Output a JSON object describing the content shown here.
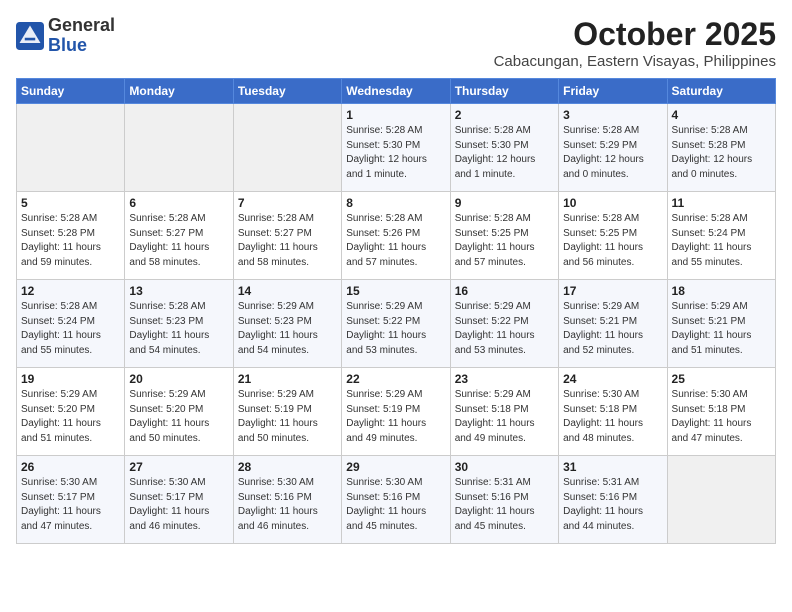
{
  "logo": {
    "general": "General",
    "blue": "Blue"
  },
  "header": {
    "month": "October 2025",
    "location": "Cabacungan, Eastern Visayas, Philippines"
  },
  "weekdays": [
    "Sunday",
    "Monday",
    "Tuesday",
    "Wednesday",
    "Thursday",
    "Friday",
    "Saturday"
  ],
  "weeks": [
    [
      {
        "day": "",
        "info": ""
      },
      {
        "day": "",
        "info": ""
      },
      {
        "day": "",
        "info": ""
      },
      {
        "day": "1",
        "info": "Sunrise: 5:28 AM\nSunset: 5:30 PM\nDaylight: 12 hours\nand 1 minute."
      },
      {
        "day": "2",
        "info": "Sunrise: 5:28 AM\nSunset: 5:30 PM\nDaylight: 12 hours\nand 1 minute."
      },
      {
        "day": "3",
        "info": "Sunrise: 5:28 AM\nSunset: 5:29 PM\nDaylight: 12 hours\nand 0 minutes."
      },
      {
        "day": "4",
        "info": "Sunrise: 5:28 AM\nSunset: 5:28 PM\nDaylight: 12 hours\nand 0 minutes."
      }
    ],
    [
      {
        "day": "5",
        "info": "Sunrise: 5:28 AM\nSunset: 5:28 PM\nDaylight: 11 hours\nand 59 minutes."
      },
      {
        "day": "6",
        "info": "Sunrise: 5:28 AM\nSunset: 5:27 PM\nDaylight: 11 hours\nand 58 minutes."
      },
      {
        "day": "7",
        "info": "Sunrise: 5:28 AM\nSunset: 5:27 PM\nDaylight: 11 hours\nand 58 minutes."
      },
      {
        "day": "8",
        "info": "Sunrise: 5:28 AM\nSunset: 5:26 PM\nDaylight: 11 hours\nand 57 minutes."
      },
      {
        "day": "9",
        "info": "Sunrise: 5:28 AM\nSunset: 5:25 PM\nDaylight: 11 hours\nand 57 minutes."
      },
      {
        "day": "10",
        "info": "Sunrise: 5:28 AM\nSunset: 5:25 PM\nDaylight: 11 hours\nand 56 minutes."
      },
      {
        "day": "11",
        "info": "Sunrise: 5:28 AM\nSunset: 5:24 PM\nDaylight: 11 hours\nand 55 minutes."
      }
    ],
    [
      {
        "day": "12",
        "info": "Sunrise: 5:28 AM\nSunset: 5:24 PM\nDaylight: 11 hours\nand 55 minutes."
      },
      {
        "day": "13",
        "info": "Sunrise: 5:28 AM\nSunset: 5:23 PM\nDaylight: 11 hours\nand 54 minutes."
      },
      {
        "day": "14",
        "info": "Sunrise: 5:29 AM\nSunset: 5:23 PM\nDaylight: 11 hours\nand 54 minutes."
      },
      {
        "day": "15",
        "info": "Sunrise: 5:29 AM\nSunset: 5:22 PM\nDaylight: 11 hours\nand 53 minutes."
      },
      {
        "day": "16",
        "info": "Sunrise: 5:29 AM\nSunset: 5:22 PM\nDaylight: 11 hours\nand 53 minutes."
      },
      {
        "day": "17",
        "info": "Sunrise: 5:29 AM\nSunset: 5:21 PM\nDaylight: 11 hours\nand 52 minutes."
      },
      {
        "day": "18",
        "info": "Sunrise: 5:29 AM\nSunset: 5:21 PM\nDaylight: 11 hours\nand 51 minutes."
      }
    ],
    [
      {
        "day": "19",
        "info": "Sunrise: 5:29 AM\nSunset: 5:20 PM\nDaylight: 11 hours\nand 51 minutes."
      },
      {
        "day": "20",
        "info": "Sunrise: 5:29 AM\nSunset: 5:20 PM\nDaylight: 11 hours\nand 50 minutes."
      },
      {
        "day": "21",
        "info": "Sunrise: 5:29 AM\nSunset: 5:19 PM\nDaylight: 11 hours\nand 50 minutes."
      },
      {
        "day": "22",
        "info": "Sunrise: 5:29 AM\nSunset: 5:19 PM\nDaylight: 11 hours\nand 49 minutes."
      },
      {
        "day": "23",
        "info": "Sunrise: 5:29 AM\nSunset: 5:18 PM\nDaylight: 11 hours\nand 49 minutes."
      },
      {
        "day": "24",
        "info": "Sunrise: 5:30 AM\nSunset: 5:18 PM\nDaylight: 11 hours\nand 48 minutes."
      },
      {
        "day": "25",
        "info": "Sunrise: 5:30 AM\nSunset: 5:18 PM\nDaylight: 11 hours\nand 47 minutes."
      }
    ],
    [
      {
        "day": "26",
        "info": "Sunrise: 5:30 AM\nSunset: 5:17 PM\nDaylight: 11 hours\nand 47 minutes."
      },
      {
        "day": "27",
        "info": "Sunrise: 5:30 AM\nSunset: 5:17 PM\nDaylight: 11 hours\nand 46 minutes."
      },
      {
        "day": "28",
        "info": "Sunrise: 5:30 AM\nSunset: 5:16 PM\nDaylight: 11 hours\nand 46 minutes."
      },
      {
        "day": "29",
        "info": "Sunrise: 5:30 AM\nSunset: 5:16 PM\nDaylight: 11 hours\nand 45 minutes."
      },
      {
        "day": "30",
        "info": "Sunrise: 5:31 AM\nSunset: 5:16 PM\nDaylight: 11 hours\nand 45 minutes."
      },
      {
        "day": "31",
        "info": "Sunrise: 5:31 AM\nSunset: 5:16 PM\nDaylight: 11 hours\nand 44 minutes."
      },
      {
        "day": "",
        "info": ""
      }
    ]
  ]
}
